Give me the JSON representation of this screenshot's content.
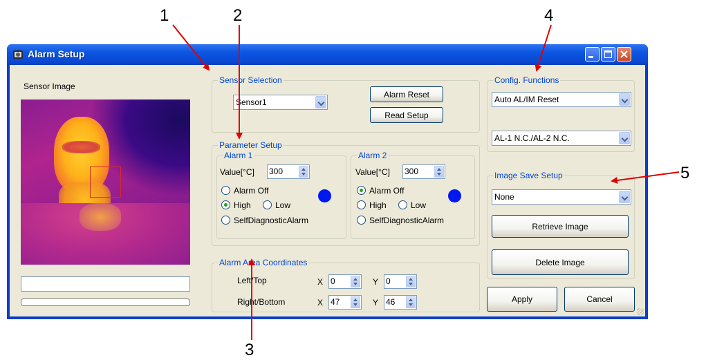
{
  "callouts": [
    "1",
    "2",
    "3",
    "4",
    "5"
  ],
  "window": {
    "title": "Alarm Setup"
  },
  "sensor_image": {
    "label": "Sensor Image"
  },
  "sensor_selection": {
    "title": "Sensor Selection",
    "selected": "Sensor1",
    "alarm_reset_label": "Alarm Reset",
    "read_setup_label": "Read Setup"
  },
  "parameter_setup": {
    "title": "Parameter Setup",
    "alarm1": {
      "title": "Alarm 1",
      "value_label": "Value[°C]",
      "value": "300",
      "opt_off": "Alarm Off",
      "opt_high": "High",
      "opt_low": "Low",
      "opt_diag": "SelfDiagnosticAlarm",
      "selected": "High",
      "led_color": "#0018f0"
    },
    "alarm2": {
      "title": "Alarm 2",
      "value_label": "Value[°C]",
      "value": "300",
      "opt_off": "Alarm Off",
      "opt_high": "High",
      "opt_low": "Low",
      "opt_diag": "SelfDiagnosticAlarm",
      "selected": "Alarm Off",
      "led_color": "#0018f0"
    }
  },
  "alarm_area": {
    "title": "Alarm Area Coordinates",
    "left_top_label": "Left/Top",
    "right_bottom_label": "Right/Bottom",
    "x_label": "X",
    "y_label": "Y",
    "left": "0",
    "top": "0",
    "right": "47",
    "bottom": "46"
  },
  "config_functions": {
    "title": "Config. Functions",
    "reset_mode": "Auto AL/IM Reset",
    "contact_mode": "AL-1 N.C./AL-2 N.C."
  },
  "image_save": {
    "title": "Image Save Setup",
    "selected": "None",
    "retrieve_label": "Retrieve Image",
    "delete_label": "Delete Image"
  },
  "footer": {
    "apply_label": "Apply",
    "cancel_label": "Cancel"
  },
  "colors": {
    "group_title": "#0046d5",
    "title_bar": "#0c55e1",
    "callout_arrow": "#e00000"
  }
}
